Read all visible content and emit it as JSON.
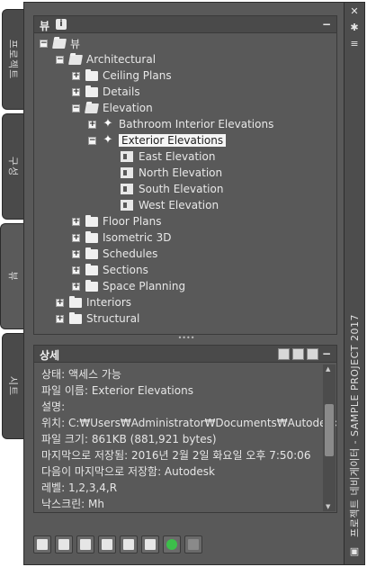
{
  "left_tabs": [
    "프로젝트",
    "구성",
    "뷰",
    "시트"
  ],
  "view_panel": {
    "title": "뷰",
    "info_icon": "i",
    "minimize": "−"
  },
  "tree": [
    {
      "label": "뷰"
    },
    {
      "label": "Architectural"
    },
    {
      "label": "Ceiling Plans"
    },
    {
      "label": "Details"
    },
    {
      "label": "Elevation"
    },
    {
      "label": "Bathroom Interior Elevations"
    },
    {
      "label": "Exterior Elevations"
    },
    {
      "label": "East Elevation"
    },
    {
      "label": "North Elevation"
    },
    {
      "label": "South Elevation"
    },
    {
      "label": "West Elevation"
    },
    {
      "label": "Floor Plans"
    },
    {
      "label": "Isometric 3D"
    },
    {
      "label": "Schedules"
    },
    {
      "label": "Sections"
    },
    {
      "label": "Space Planning"
    },
    {
      "label": "Interiors"
    },
    {
      "label": "Structural"
    }
  ],
  "details_panel": {
    "title": "상세",
    "minimize": "−",
    "lines": [
      "상태: 액세스 가능",
      "파일 이름: Exterior Elevations",
      "설명:",
      "위치: C:₩Users₩Administrator₩Documents₩Autodesk₩내",
      "파일 크기: 861KB (881,921 bytes)",
      "마지막으로 저장됨: 2016년 2월 2일 화요일  오후 7:50:06",
      "다음이 마지막으로 저장함: Autodesk",
      "레벨: 1,2,3,4,R",
      "낙스크린: Mh"
    ]
  },
  "right_bar": {
    "title": "프로젝트 네비게이터 - SAMPLE PROJECT 2017",
    "close_glyph": "✕",
    "pin_glyph": "✱",
    "menu_glyph": "≡"
  },
  "colors": {
    "panel_bg": "#595959",
    "header_bg": "#4a4a4a",
    "selection_bg": "#f5f5f5"
  }
}
